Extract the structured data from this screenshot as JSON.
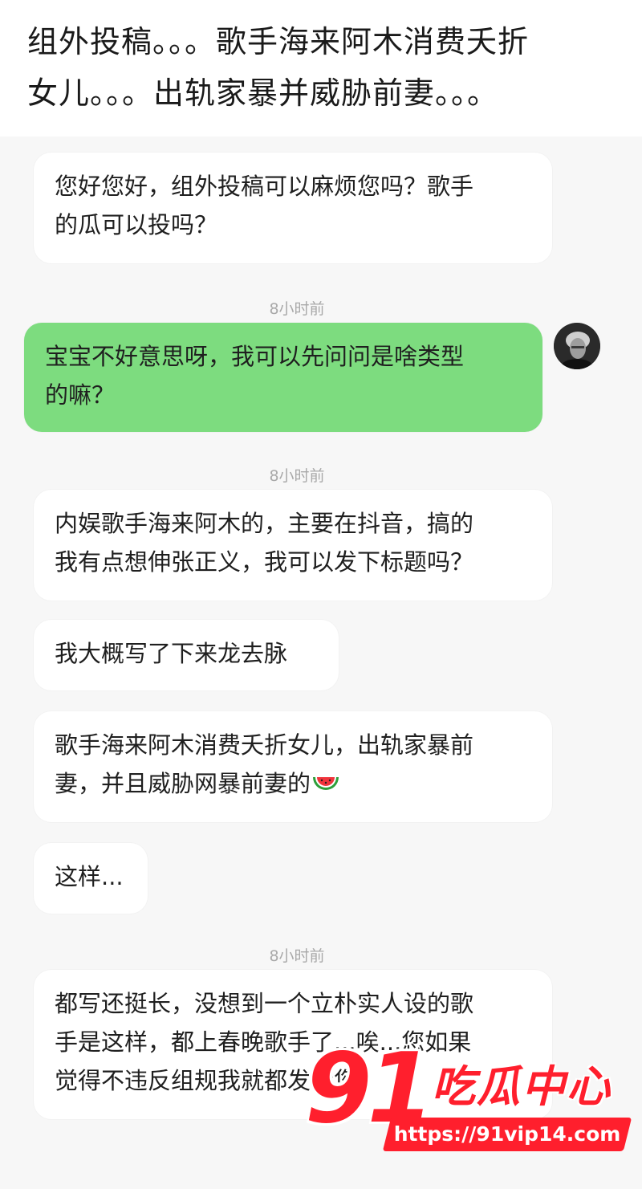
{
  "headline": {
    "line1": "组外投稿。。。歌手海来阿木消费夭折",
    "line2": "女儿。。。出轨家暴并威胁前妻。。。"
  },
  "messages": [
    {
      "type": "recv",
      "lines": [
        "您好您好，组外投稿可以麻烦您吗？歌手",
        "的瓜可以投吗？"
      ]
    },
    {
      "type": "time",
      "text": "8小时前"
    },
    {
      "type": "sent",
      "lines": [
        "宝宝不好意思呀，我可以先问问是啥类型",
        "的嘛？"
      ]
    },
    {
      "type": "time",
      "text": "8小时前"
    },
    {
      "type": "recv",
      "lines": [
        "内娱歌手海来阿木的，主要在抖音，搞的",
        "我有点想伸张正义，我可以发下标题吗？"
      ]
    },
    {
      "type": "recv",
      "lines": [
        "我大概写了下来龙去脉"
      ]
    },
    {
      "type": "recv",
      "lines": [
        "歌手海来阿木消费夭折女儿，出轨家暴前",
        "妻，并且威胁网暴前妻的"
      ],
      "emoji": "watermelon-icon"
    },
    {
      "type": "recv",
      "lines": [
        "这样..."
      ]
    },
    {
      "type": "time",
      "text": "8小时前"
    },
    {
      "type": "recv",
      "lines": [
        "都写还挺长，没想到一个立朴实人设的歌",
        "手是这样，都上春晚歌手了...唉...您如果",
        "觉得不违反组规我就都发给您"
      ]
    }
  ],
  "watermark": {
    "number": "91",
    "title": "吃瓜中心",
    "url": "https://91vip14.com"
  },
  "colors": {
    "sent_bubble": "#7ddc7f",
    "recv_bubble": "#ffffff",
    "background": "#f7f7f7",
    "watermark_red": "#ff1f2d"
  }
}
